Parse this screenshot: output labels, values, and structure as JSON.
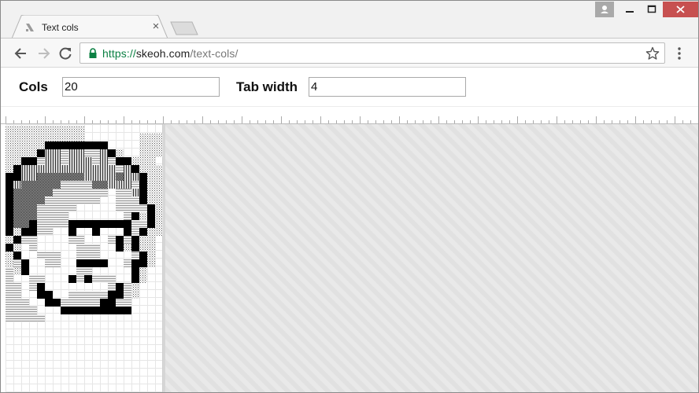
{
  "browser": {
    "tab_title": "Text cols",
    "tab_close_glyph": "×",
    "url_scheme": "https://",
    "url_host": "skeoh.com",
    "url_path": "/text-cols/"
  },
  "controls": {
    "cols_label": "Cols",
    "cols_value": "20",
    "tab_width_label": "Tab width",
    "tab_width_value": "4"
  },
  "colors": {
    "secure": "#0b8043",
    "close_button": "#c75050",
    "overflow_bg": "#e6e6e6"
  },
  "icons": [
    "back-icon",
    "forward-icon",
    "reload-icon",
    "lock-icon",
    "star-icon",
    "menu-icon",
    "user-icon",
    "minimize-icon",
    "maximize-icon",
    "close-icon"
  ]
}
